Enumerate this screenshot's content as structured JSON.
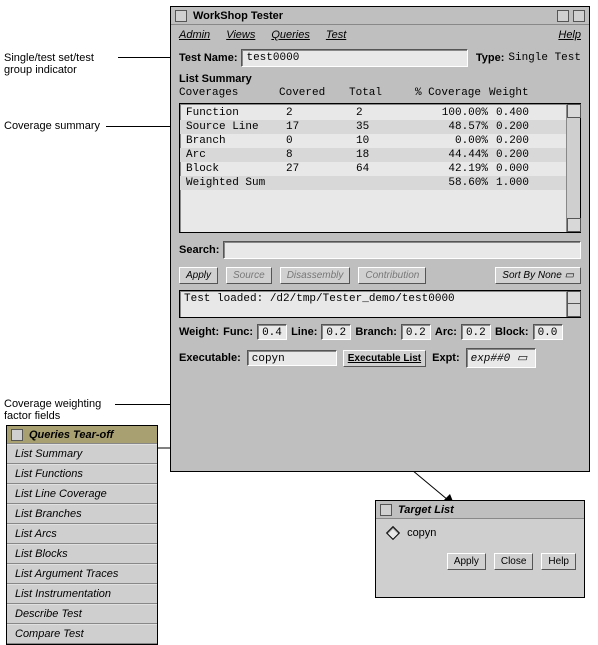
{
  "window": {
    "title": "WorkShop Tester",
    "menus": {
      "admin": "Admin",
      "views": "Views",
      "queries": "Queries",
      "test": "Test",
      "help": "Help"
    },
    "testname_label": "Test Name:",
    "testname_value": "test0000",
    "type_label": "Type:",
    "type_value": "Single Test",
    "summary_title": "List Summary",
    "headers": {
      "coverages": "Coverages",
      "covered": "Covered",
      "total": "Total",
      "pct": "% Coverage",
      "weight": "Weight"
    },
    "rows": [
      {
        "name": "Function",
        "covered": "2",
        "total": "2",
        "pct": "100.00%",
        "weight": "0.400"
      },
      {
        "name": "Source Line",
        "covered": "17",
        "total": "35",
        "pct": "48.57%",
        "weight": "0.200"
      },
      {
        "name": "Branch",
        "covered": "0",
        "total": "10",
        "pct": "0.00%",
        "weight": "0.200"
      },
      {
        "name": "Arc",
        "covered": "8",
        "total": "18",
        "pct": "44.44%",
        "weight": "0.200"
      },
      {
        "name": "Block",
        "covered": "27",
        "total": "64",
        "pct": "42.19%",
        "weight": "0.000"
      },
      {
        "name": "Weighted Sum",
        "covered": "",
        "total": "",
        "pct": "58.60%",
        "weight": "1.000"
      }
    ],
    "search_label": "Search:",
    "search_value": "",
    "buttons": {
      "apply": "Apply",
      "source": "Source",
      "disassembly": "Disassembly",
      "contribution": "Contribution",
      "sort": "Sort By None"
    },
    "status_msg": "Test loaded: /d2/tmp/Tester_demo/test0000",
    "weights": {
      "label": "Weight:",
      "func_label": "Func:",
      "func": "0.4",
      "line_label": "Line:",
      "line": "0.2",
      "branch_label": "Branch:",
      "branch": "0.2",
      "arc_label": "Arc:",
      "arc": "0.2",
      "block_label": "Block:",
      "block": "0.0"
    },
    "exec": {
      "label": "Executable:",
      "value": "copyn",
      "list_btn": "Executable List",
      "expt_label": "Expt:",
      "expt_value": "exp##0"
    }
  },
  "tearoff": {
    "title": "Queries Tear-off",
    "items": [
      "List Summary",
      "List Functions",
      "List Line Coverage",
      "List Branches",
      "List Arcs",
      "List Blocks",
      "List Argument Traces",
      "List Instrumentation",
      "Describe Test",
      "Compare Test"
    ]
  },
  "target": {
    "title": "Target List",
    "item": "copyn",
    "buttons": {
      "apply": "Apply",
      "close": "Close",
      "help": "Help"
    }
  },
  "annotations": {
    "a1": "Single/test set/test\ngroup indicator",
    "a2": "Coverage summary",
    "a3": "Coverage weighting\nfactor fields"
  }
}
